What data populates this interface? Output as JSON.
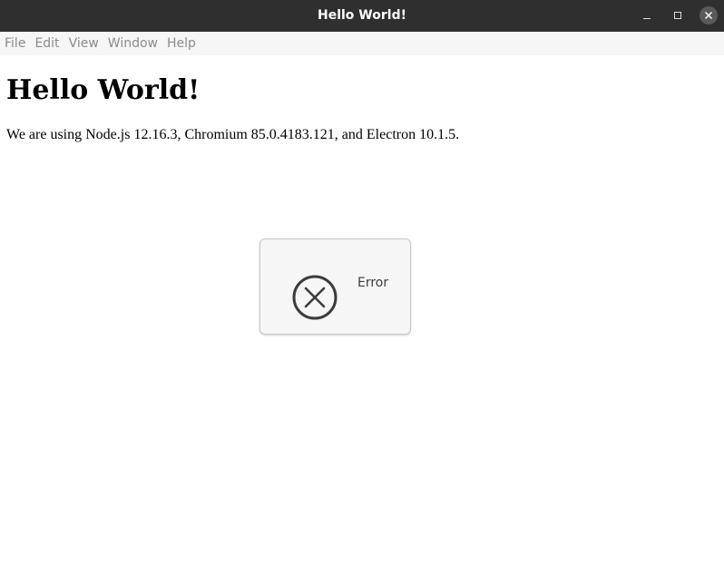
{
  "window": {
    "title": "Hello World!"
  },
  "menubar": {
    "items": [
      {
        "label": "File"
      },
      {
        "label": "Edit"
      },
      {
        "label": "View"
      },
      {
        "label": "Window"
      },
      {
        "label": "Help"
      }
    ]
  },
  "content": {
    "heading": "Hello World!",
    "versions_text": "We are using Node.js 12.16.3, Chromium 85.0.4183.121, and Electron 10.1.5."
  },
  "dialog": {
    "icon": "error-circle-x-icon",
    "message": "Error"
  },
  "colors": {
    "titlebar_bg": "#2f2f2f",
    "menubar_bg": "#f6f6f6",
    "dialog_bg": "#f6f6f6",
    "icon_color": "#3c3c3c"
  }
}
